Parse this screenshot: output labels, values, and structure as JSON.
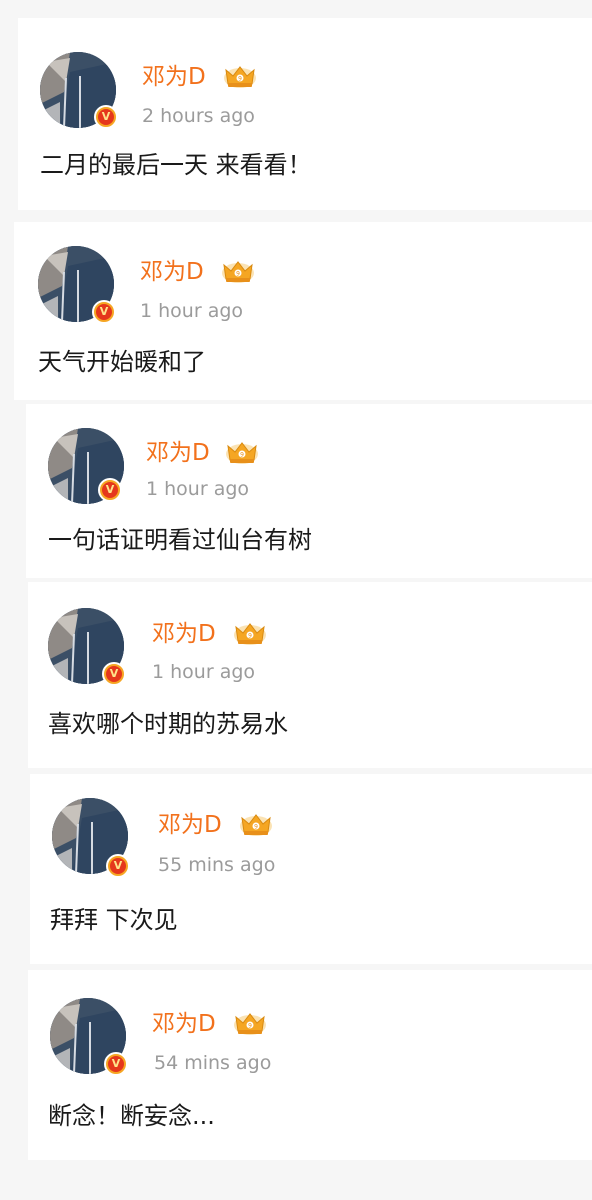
{
  "colors": {
    "background": "#f6f6f6",
    "card": "#ffffff",
    "username": "#f2711c",
    "timestamp": "#9b9b9b",
    "text": "#1a1a1a",
    "verified_badge": "#e5371c",
    "crown": "#f5a623"
  },
  "posts": [
    {
      "username": "邓为D",
      "verified": "V",
      "crown_icon": "crown-icon",
      "time": "2 hours ago",
      "content": "二月的最后一天 来看看！"
    },
    {
      "username": "邓为D",
      "verified": "V",
      "crown_icon": "crown-icon",
      "time": "1 hour ago",
      "content": "天气开始暖和了"
    },
    {
      "username": "邓为D",
      "verified": "V",
      "crown_icon": "crown-icon",
      "time": "1 hour ago",
      "content": "一句话证明看过仙台有树"
    },
    {
      "username": "邓为D",
      "verified": "V",
      "crown_icon": "crown-icon",
      "time": "1 hour ago",
      "content": "喜欢哪个时期的苏易水"
    },
    {
      "username": "邓为D",
      "verified": "V",
      "crown_icon": "crown-icon",
      "time": "55 mins ago",
      "content": "拜拜 下次见"
    },
    {
      "username": "邓为D",
      "verified": "V",
      "crown_icon": "crown-icon",
      "time": "54 mins ago",
      "content": "断念！断妄念..."
    }
  ]
}
